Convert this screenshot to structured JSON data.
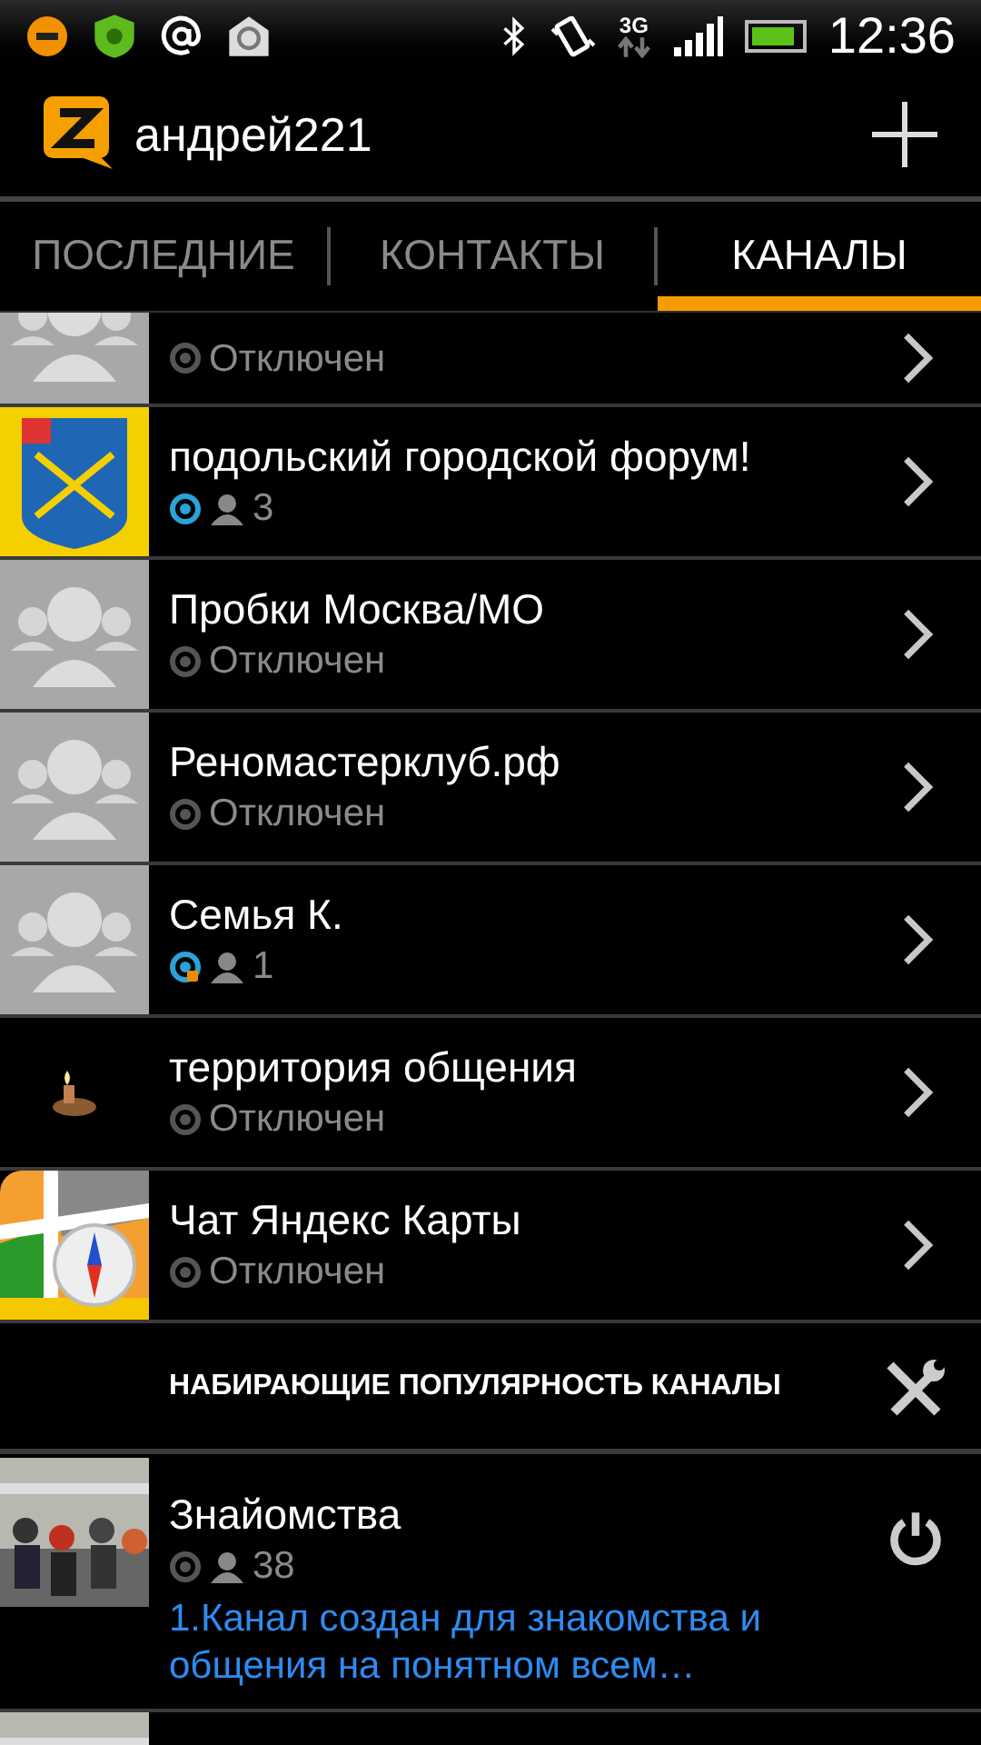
{
  "status_bar": {
    "network": "3G",
    "time": "12:36"
  },
  "header": {
    "account": "андрей221"
  },
  "tabs": [
    {
      "label": "ПОСЛЕДНИЕ",
      "selected": false
    },
    {
      "label": "КОНТАКТЫ",
      "selected": false
    },
    {
      "label": "КАНАЛЫ",
      "selected": true
    }
  ],
  "channels": [
    {
      "kind": "group",
      "online": false,
      "alert": false,
      "status_text": "Отключен"
    },
    {
      "kind": "coat_of_arms",
      "title": "подольский городской форум!",
      "online": true,
      "alert": false,
      "members": "3"
    },
    {
      "kind": "group",
      "title": "Пробки Москва/МО",
      "online": false,
      "alert": false,
      "status_text": "Отключен"
    },
    {
      "kind": "group",
      "title": "Реномастерклуб.рф",
      "online": false,
      "alert": false,
      "status_text": "Отключен"
    },
    {
      "kind": "group",
      "title": "Семья К.",
      "online": true,
      "alert": true,
      "members": "1"
    },
    {
      "kind": "lighter",
      "title": "территория общения",
      "online": false,
      "alert": false,
      "status_text": "Отключен"
    },
    {
      "kind": "maps",
      "title": "Чат Яндекс Карты",
      "online": false,
      "alert": false,
      "status_text": "Отключен"
    }
  ],
  "trending": {
    "title": "НАБИРАЮЩИЕ ПОПУЛЯРНОСТЬ КАНАЛЫ",
    "channels": [
      {
        "title": "Знайомства",
        "members": "38",
        "description": "1.Канал создан для знакомства и общения на понятном всем…"
      }
    ]
  }
}
